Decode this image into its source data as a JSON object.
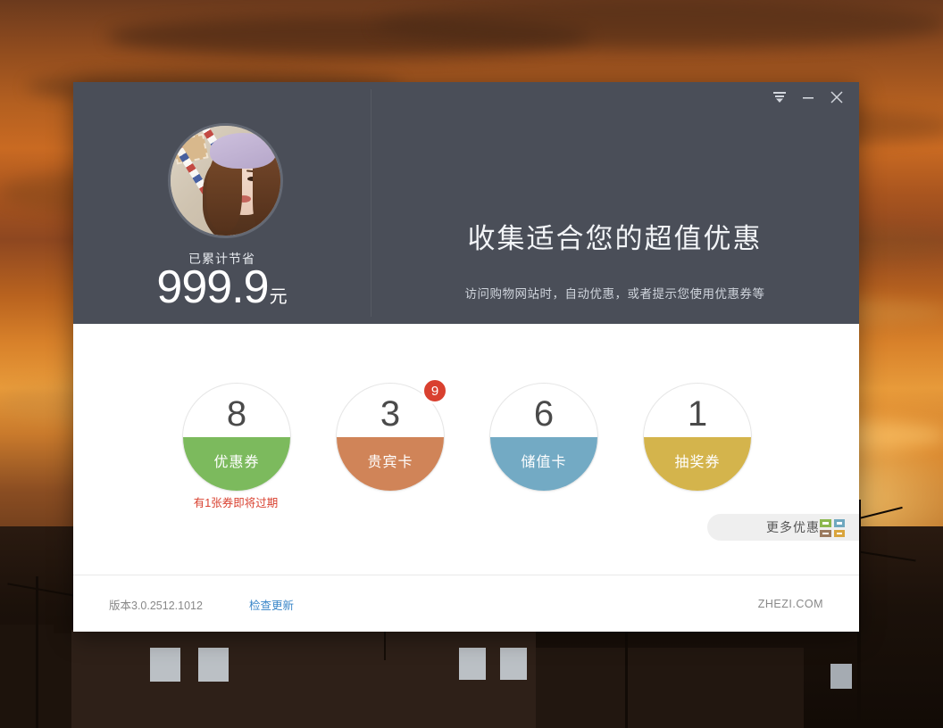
{
  "window": {
    "controls": [
      {
        "name": "menu",
        "glyph": "menu-arrow-icon"
      },
      {
        "name": "minimize",
        "glyph": "minimize-icon"
      },
      {
        "name": "close",
        "glyph": "close-icon"
      }
    ]
  },
  "profile": {
    "avatar_alt": "user-avatar",
    "saved_label": "已累计节省",
    "saved_amount": "999.9",
    "saved_unit": "元"
  },
  "pitch": {
    "title": "收集适合您的超值优惠",
    "subtitle": "访问购物网站时，自动优惠，或者提示您使用优惠券等"
  },
  "expand": {
    "icon": "chevron-down-icon",
    "color": "#79b3ce"
  },
  "cards": [
    {
      "count": "8",
      "label": "优惠券",
      "color": "#7cba5d",
      "badge": null,
      "warning": "有1张券即将过期"
    },
    {
      "count": "3",
      "label": "贵宾卡",
      "color": "#d08458",
      "badge": "9",
      "warning": null
    },
    {
      "count": "6",
      "label": "储值卡",
      "color": "#73aac4",
      "badge": null,
      "warning": null
    },
    {
      "count": "1",
      "label": "抽奖券",
      "color": "#d4b44c",
      "badge": null,
      "warning": null
    }
  ],
  "more_button": {
    "label": "更多优惠",
    "icon": "grid-squares-icon",
    "square_colors": [
      "#8cb84e",
      "#6fa8bf",
      "#9b7a5e",
      "#d9a43c"
    ]
  },
  "footer": {
    "version": "版本3.0.2512.1012",
    "update_link": "检查更新",
    "site": "ZHEZI.COM"
  },
  "badge_color": "#d9402f",
  "header_color": "#4a4e58"
}
